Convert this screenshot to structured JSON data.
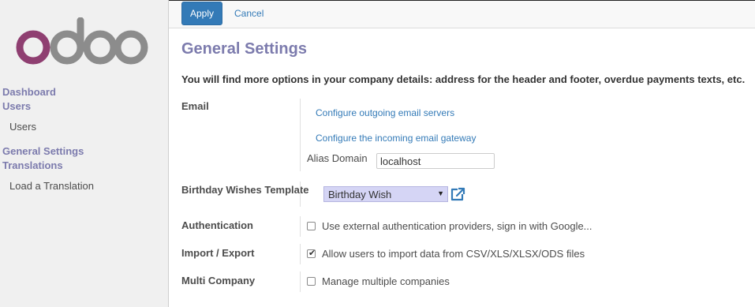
{
  "brand": {
    "logo_text": "odoo",
    "logo_colors": [
      "#8f3f71",
      "#8c8c8c"
    ]
  },
  "sidebar": {
    "groups": [
      {
        "label": "Dashboard"
      },
      {
        "label": "Users",
        "items": [
          "Users"
        ]
      },
      {
        "label": "General Settings"
      },
      {
        "label": "Translations",
        "items": [
          "Load a Translation"
        ]
      }
    ]
  },
  "toolbar": {
    "apply_label": "Apply",
    "cancel_label": "Cancel"
  },
  "page": {
    "title": "General Settings",
    "intro": "You will find more options in your company details: address for the header and footer, overdue payments texts, etc."
  },
  "email": {
    "label": "Email",
    "link_outgoing": "Configure outgoing email servers",
    "link_incoming": "Configure the incoming email gateway",
    "alias_label": "Alias Domain",
    "alias_value": "localhost"
  },
  "birthday": {
    "label": "Birthday Wishes Template",
    "selected": "Birthday Wish"
  },
  "authentication": {
    "label": "Authentication",
    "option": "Use external authentication providers, sign in with Google...",
    "checked": false
  },
  "import_export": {
    "label": "Import / Export",
    "option": "Allow users to import data from CSV/XLS/XLSX/ODS files",
    "checked": true
  },
  "multi_company": {
    "label": "Multi Company",
    "option": "Manage multiple companies",
    "checked": false
  },
  "colors": {
    "accent": "#7c7bad",
    "primary": "#337ab7",
    "sidebar_bg": "#f0f0f0",
    "select_bg": "#d5d5f5"
  }
}
